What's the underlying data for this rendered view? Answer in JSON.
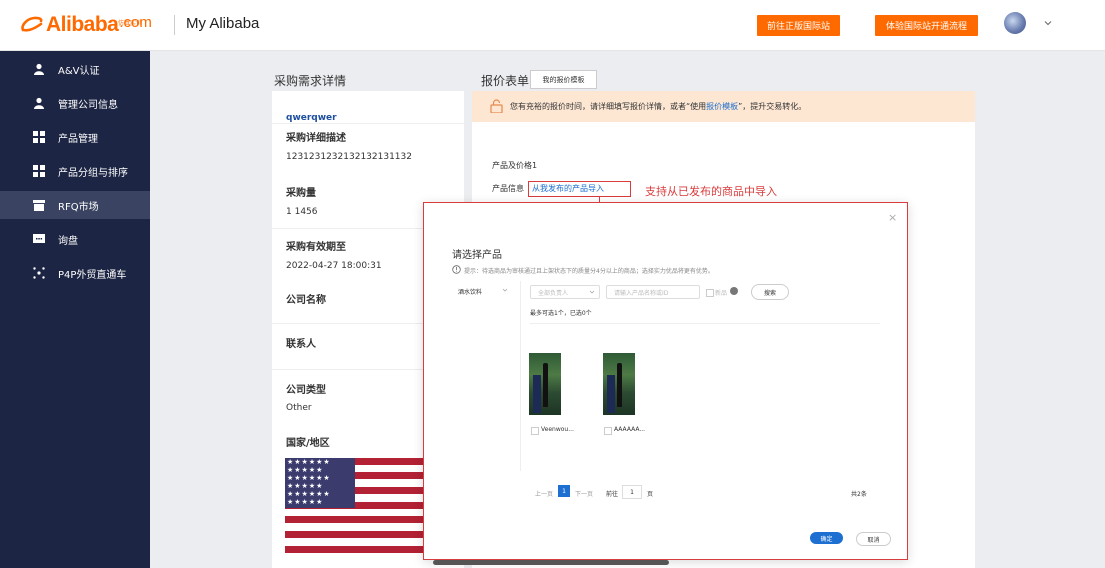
{
  "header": {
    "logo_text": "Alibaba",
    "logo_com": ".com",
    "logo_sub": "仿真实训",
    "title": "My Alibaba",
    "btn_go_intl": "前往正版国际站",
    "btn_experience": "体验国际站开通流程"
  },
  "sidebar": {
    "items": [
      {
        "label": "A&V认证",
        "icon": "user-icon"
      },
      {
        "label": "管理公司信息",
        "icon": "user-icon"
      },
      {
        "label": "产品管理",
        "icon": "grid-icon"
      },
      {
        "label": "产品分组与排序",
        "icon": "grid-icon"
      },
      {
        "label": "RFQ市场",
        "icon": "store-icon"
      },
      {
        "label": "询盘",
        "icon": "chat-icon"
      },
      {
        "label": "P4P外贸直通车",
        "icon": "sparkle-icon"
      }
    ],
    "active_index": 4
  },
  "left_section": {
    "title": "采购需求详情",
    "buyer": "qwerqwer",
    "desc_label": "采购详细描述",
    "desc_value": "1231231232132132131132",
    "qty_label": "采购量",
    "qty_value": "1 1456",
    "valid_label": "采购有效期至",
    "valid_value": "2022-04-27 18:00:31",
    "company_label": "公司名称",
    "contact_label": "联系人",
    "type_label": "公司类型",
    "type_value": "Other",
    "country_label": "国家/地区"
  },
  "right_section": {
    "title": "报价表单",
    "template_btn": "我的报价模板",
    "notice_pre": "您有充裕的报价时间，请详细填写报价详情，或者“使用",
    "notice_link": "报价模板",
    "notice_post": "”，提升交易转化。",
    "product_price": "产品及价格1",
    "product_info_label": "产品信息",
    "import_link": "从我发布的产品导入"
  },
  "annotation": {
    "text": "支持从已发布的商品中导入"
  },
  "modal": {
    "title": "请选择产品",
    "tip": "提示：待选商品为审核通过且上架状态下的质量分4分以上的商品；选择实力优品将更有优势。",
    "category": "酒水饮料",
    "owner_placeholder": "全部负责人",
    "search_placeholder": "请输入产品名称或ID",
    "quality_label": "新品",
    "search_btn": "搜索",
    "select_hint": "最多可选1个，已选0个",
    "products": [
      {
        "name": "Veenwou..."
      },
      {
        "name": "AAAAAA..."
      }
    ],
    "pager": {
      "prev": "上一页",
      "current": "1",
      "next": "下一页",
      "goto": "前往",
      "goto_value": "1",
      "page_unit": "页",
      "total": "共2条"
    },
    "confirm": "确定",
    "cancel": "取消",
    "close": "×"
  }
}
